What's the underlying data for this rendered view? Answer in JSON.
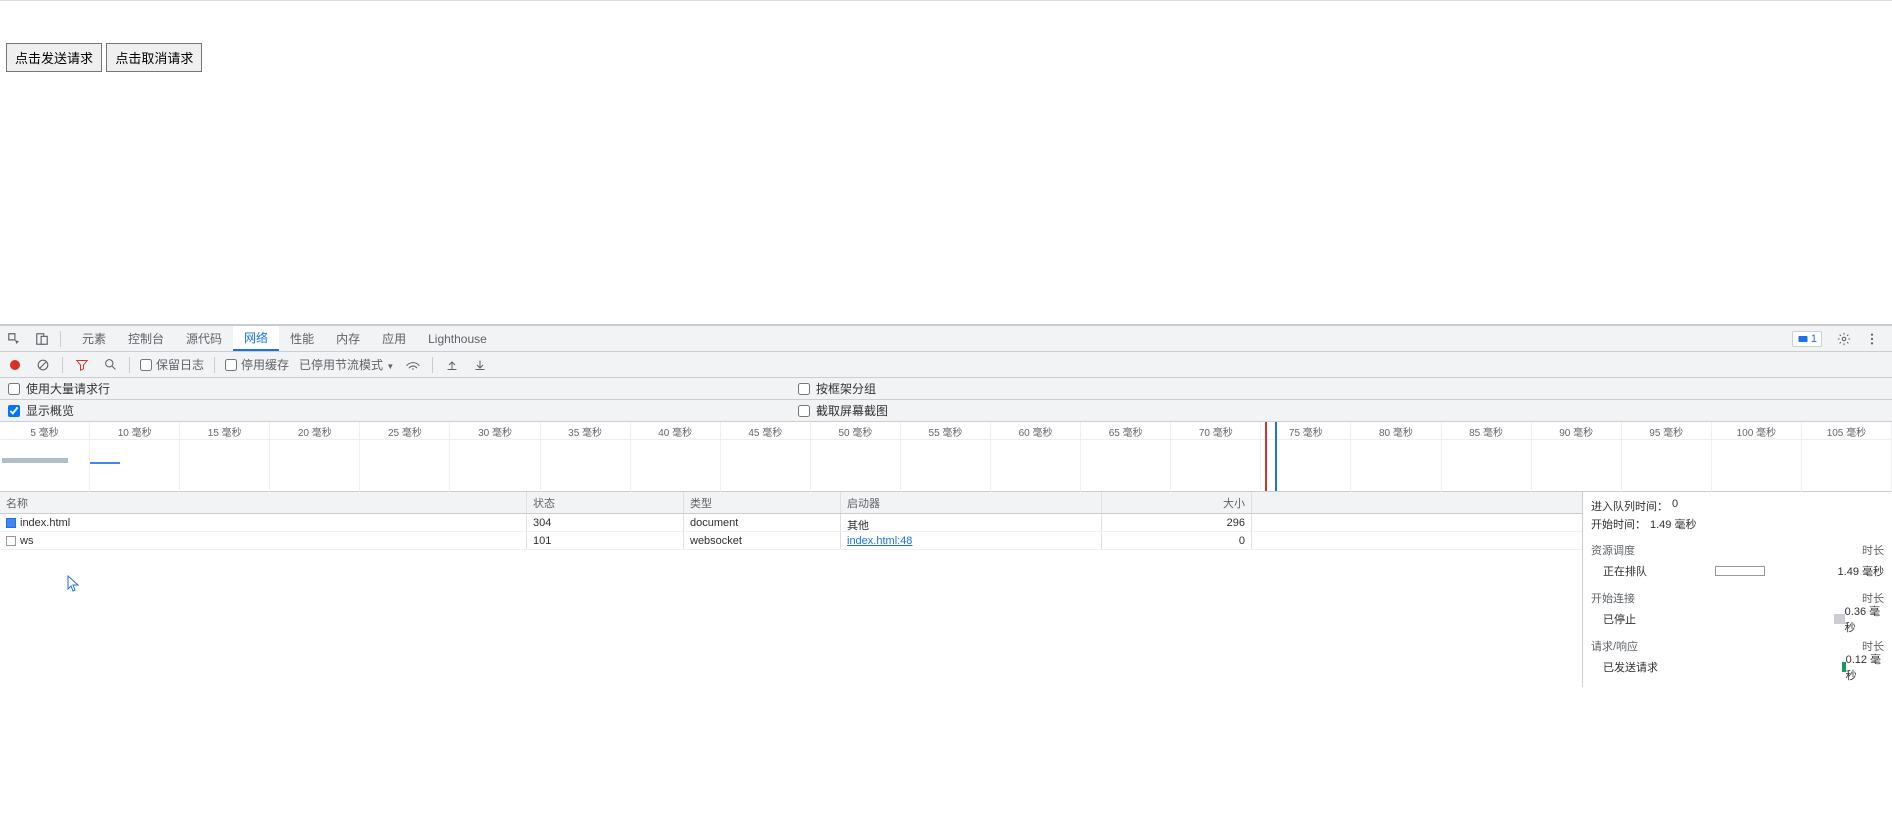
{
  "page": {
    "btn_send": "点击发送请求",
    "btn_cancel": "点击取消请求"
  },
  "tabs": {
    "elements": "元素",
    "console": "控制台",
    "sources": "源代码",
    "network": "网络",
    "performance": "性能",
    "memory": "内存",
    "application": "应用",
    "lighthouse": "Lighthouse"
  },
  "right_chip_count": "1",
  "toolbar": {
    "preserve_log": "保留日志",
    "disable_cache": "停用缓存",
    "throttling_label": "已停用节流模式"
  },
  "options": {
    "big_rows": "使用大量请求行",
    "group_by_frame": "按框架分组",
    "show_overview": "显示概览",
    "capture_screenshots": "截取屏幕截图"
  },
  "timeline_labels": [
    "5 毫秒",
    "10 毫秒",
    "15 毫秒",
    "20 毫秒",
    "25 毫秒",
    "30 毫秒",
    "35 毫秒",
    "40 毫秒",
    "45 毫秒",
    "50 毫秒",
    "55 毫秒",
    "60 毫秒",
    "65 毫秒",
    "70 毫秒",
    "75 毫秒",
    "80 毫秒",
    "85 毫秒",
    "90 毫秒",
    "95 毫秒",
    "100 毫秒",
    "105 毫秒"
  ],
  "table": {
    "headers": {
      "name": "名称",
      "status": "状态",
      "type": "类型",
      "initiator": "启动器",
      "size": "大小"
    },
    "rows": [
      {
        "name": "index.html",
        "status": "304",
        "type": "document",
        "initiator": "其他",
        "initiator_link": false,
        "size": "296",
        "icon": "doc"
      },
      {
        "name": "ws",
        "status": "101",
        "type": "websocket",
        "initiator": "index.html:48",
        "initiator_link": true,
        "size": "0",
        "icon": "other"
      }
    ]
  },
  "timing": {
    "queued_label": "进入队列时间：",
    "queued_value": "0",
    "started_label": "开始时间：",
    "started_value": "1.49 毫秒",
    "sec_scheduling": "资源调度",
    "sec_connection": "开始连接",
    "sec_reqresp": "请求/响应",
    "col_duration": "时长",
    "queueing_label": "正在排队",
    "queueing_value": "1.49 毫秒",
    "stalled_label": "已停止",
    "stalled_value": "0.36 毫秒",
    "sent_label": "已发送请求",
    "sent_value": "0.12 毫秒"
  }
}
